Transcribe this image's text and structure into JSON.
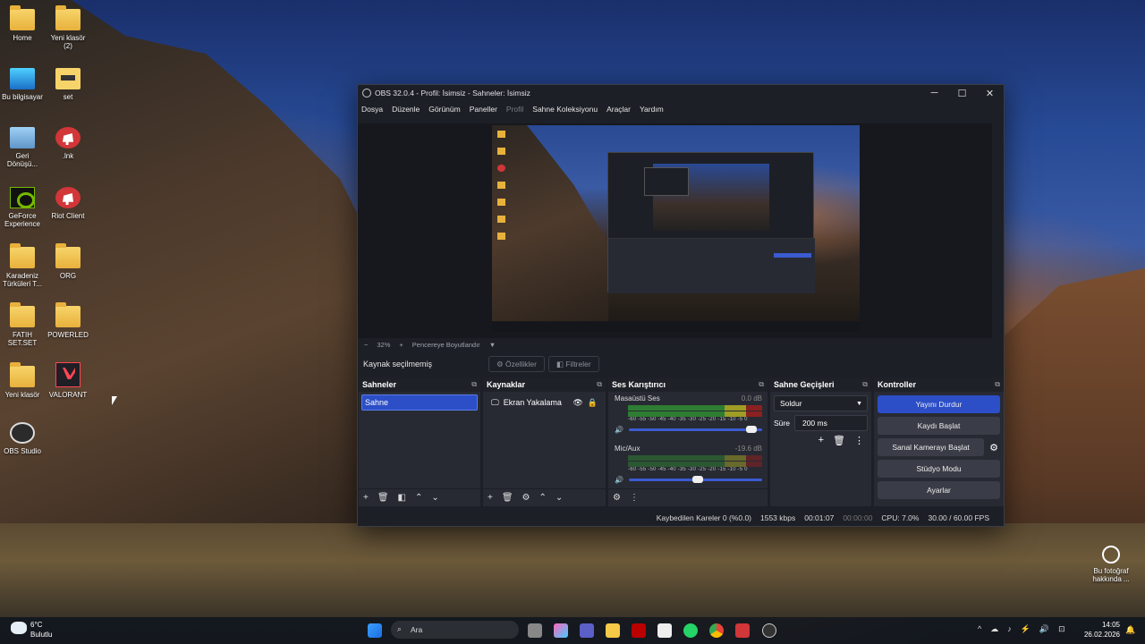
{
  "desktop": {
    "icons": [
      {
        "label": "Home"
      },
      {
        "label": "Yeni klasör (2)"
      },
      {
        "label": "Bu bilgisayar"
      },
      {
        "label": "set"
      },
      {
        "label": "Geri Dönüşü..."
      },
      {
        "label": ".lnk"
      },
      {
        "label": "GeForce Experience"
      },
      {
        "label": "Riot Client"
      },
      {
        "label": "Karadeniz Türküleri T..."
      },
      {
        "label": "ORG"
      },
      {
        "label": "FATIH SET.SET"
      },
      {
        "label": "POWERLED"
      },
      {
        "label": "Yeni klasör"
      },
      {
        "label": "VALORANT"
      },
      {
        "label": "OBS Studio"
      }
    ],
    "photo_info": "Bu fotoğraf hakkında ..."
  },
  "obs": {
    "title": "OBS 32.0.4 - Profil: İsimsiz - Sahneler: İsimsiz",
    "window_buttons": {
      "minimize": "─",
      "maximize": "☐",
      "close": "✕"
    },
    "menu": [
      "Dosya",
      "Düzenle",
      "Görünüm",
      "Paneller",
      "Profil",
      "Sahne Koleksiyonu",
      "Araçlar",
      "Yardım"
    ],
    "preview_bar": {
      "minus": "−",
      "zoom": "32%",
      "plus": "+",
      "fit": "Pencereye Boyutlandır",
      "arrow": "▼"
    },
    "no_source": "Kaynak seçilmemiş",
    "properties": "Özellikler",
    "filters": "Filtreler",
    "scenes": {
      "title": "Sahneler",
      "items": [
        "Sahne"
      ]
    },
    "sources": {
      "title": "Kaynaklar",
      "items": [
        "Ekran Yakalama"
      ]
    },
    "mixer": {
      "title": "Ses Karıştırıcı",
      "channels": [
        {
          "name": "Masaüstü Ses",
          "db": "0.0 dB",
          "volume": 0.92
        },
        {
          "name": "Mic/Aux",
          "db": "-19.6 dB",
          "volume": 0.52
        }
      ],
      "scale": "-60 -55 -50 -45 -40 -35 -30 -25 -20 -15 -10 -5 0"
    },
    "transitions": {
      "title": "Sahne Geçişleri",
      "type": "Soldur",
      "duration_label": "Süre",
      "duration": "200 ms"
    },
    "controls": {
      "title": "Kontroller",
      "stop_stream": "Yayını Durdur",
      "start_record": "Kaydı Başlat",
      "virtual_cam": "Sanal Kamerayı Başlat",
      "studio_mode": "Stüdyo Modu",
      "settings": "Ayarlar"
    },
    "status": {
      "dropped": "Kaybedilen Kareler 0 (%0.0)",
      "bitrate": "1553 kbps",
      "stream_time": "00:01:07",
      "record_time": "00:00:00",
      "cpu": "CPU: 7.0%",
      "fps": "30.00 / 60.00 FPS"
    }
  },
  "taskbar": {
    "weather_temp": "6°C",
    "weather_desc": "Bulutlu",
    "search": "Ara",
    "time": "14:05",
    "date": "26.02.2026"
  }
}
